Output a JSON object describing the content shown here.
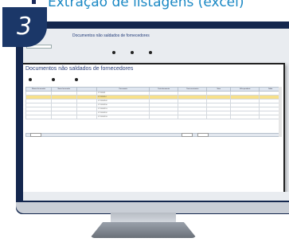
{
  "heading": "Extração de listagens (excel)",
  "step_number": "3",
  "back_window": {
    "title": "Documentos não saldados de fornecedores"
  },
  "front_window": {
    "title": "Documentos não saldados de fornecedores",
    "columns": [
      "Número fornecedor",
      "Nome fornecedor",
      "",
      "Documento",
      "Data documento",
      "Data vencimento",
      "Valor",
      "Valor pendente",
      "Saldo"
    ],
    "rows": [
      [
        "",
        "",
        "",
        "FT 2021/1",
        "",
        "",
        "",
        "",
        ""
      ],
      [
        "",
        "",
        "",
        "FT 2021/14",
        "",
        "",
        "",
        "",
        ""
      ],
      [
        "",
        "",
        "",
        "FT 2021/102",
        "",
        "",
        "",
        "",
        ""
      ],
      [
        "",
        "",
        "",
        "FT 2021/150",
        "",
        "",
        "",
        "",
        ""
      ],
      [
        "",
        "",
        "",
        "FT 2021/151",
        "",
        "",
        "",
        "",
        ""
      ],
      [
        "",
        "",
        "",
        "FT 2021/152",
        "",
        "",
        "",
        "",
        ""
      ],
      [
        "",
        "",
        "",
        "FT 2021/153",
        "",
        "",
        "",
        "",
        ""
      ]
    ],
    "selected_row": 1
  },
  "colors": {
    "brand_dark": "#1b3768",
    "heading_blue": "#1a88c4",
    "selection": "#f7e08a"
  }
}
